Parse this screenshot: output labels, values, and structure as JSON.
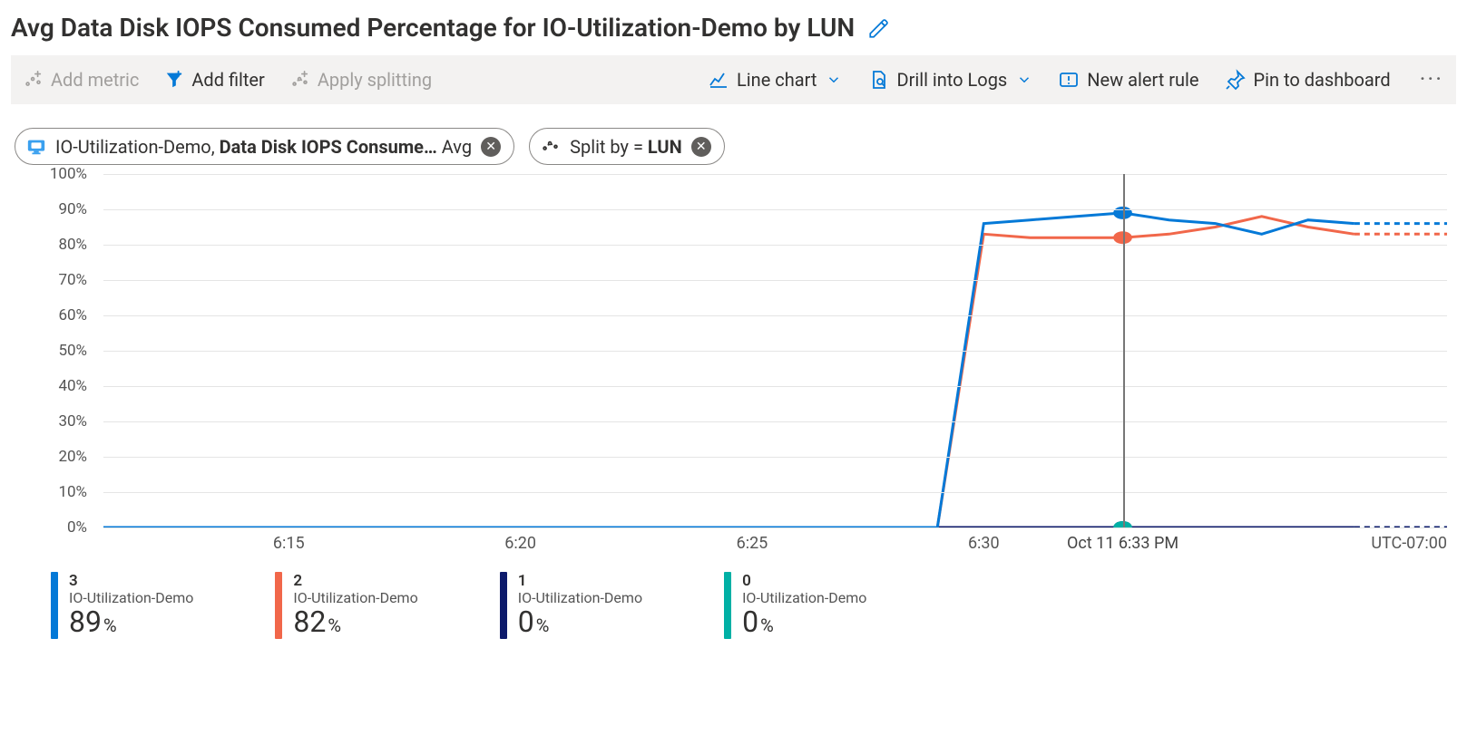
{
  "title": "Avg Data Disk IOPS Consumed Percentage for IO-Utilization-Demo by LUN",
  "toolbar": {
    "add_metric": "Add metric",
    "add_filter": "Add filter",
    "apply_splitting": "Apply splitting",
    "line_chart": "Line chart",
    "drill_logs": "Drill into Logs",
    "new_alert": "New alert rule",
    "pin": "Pin to dashboard"
  },
  "pills": {
    "metric_resource": "IO-Utilization-Demo, ",
    "metric_name": "Data Disk IOPS Consume…",
    "metric_agg": " Avg",
    "split_prefix": "Split by = ",
    "split_value": "LUN"
  },
  "chart_data": {
    "type": "line",
    "ylim": [
      0,
      100
    ],
    "y_ticks": [
      0,
      10,
      20,
      30,
      40,
      50,
      60,
      70,
      80,
      90,
      100
    ],
    "y_tick_labels": [
      "0%",
      "10%",
      "20%",
      "30%",
      "40%",
      "50%",
      "60%",
      "70%",
      "80%",
      "90%",
      "100%"
    ],
    "x": [
      "6:11",
      "6:12",
      "6:13",
      "6:14",
      "6:15",
      "6:16",
      "6:17",
      "6:18",
      "6:19",
      "6:20",
      "6:21",
      "6:22",
      "6:23",
      "6:24",
      "6:25",
      "6:26",
      "6:27",
      "6:28",
      "6:29",
      "6:30",
      "6:31",
      "6:32",
      "6:33",
      "6:34",
      "6:35",
      "6:36",
      "6:37",
      "6:38",
      "6:39",
      "6:40"
    ],
    "x_tick_positions": [
      4,
      9,
      14,
      19
    ],
    "x_tick_labels": [
      "6:15",
      "6:20",
      "6:25",
      "6:30"
    ],
    "tz": "UTC-07:00",
    "cursor_index": 22,
    "cursor_label": "Oct 11 6:33 PM",
    "dashed_from_index": 27,
    "series": [
      {
        "name": "3",
        "resource": "IO-Utilization-Demo",
        "color": "#0479d7",
        "current": 89,
        "values": [
          0,
          0,
          0,
          0,
          0,
          0,
          0,
          0,
          0,
          0,
          0,
          0,
          0,
          0,
          0,
          0,
          0,
          0,
          0,
          86,
          87,
          88,
          89,
          87,
          86,
          83,
          87,
          86,
          86,
          86
        ]
      },
      {
        "name": "2",
        "resource": "IO-Utilization-Demo",
        "color": "#f1674a",
        "current": 82,
        "values": [
          0,
          0,
          0,
          0,
          0,
          0,
          0,
          0,
          0,
          0,
          0,
          0,
          0,
          0,
          0,
          0,
          0,
          0,
          0,
          83,
          82,
          82,
          82,
          83,
          85,
          88,
          85,
          83,
          83,
          83
        ]
      },
      {
        "name": "1",
        "resource": "IO-Utilization-Demo",
        "color": "#0d1a6b",
        "current": 0,
        "values": [
          0,
          0,
          0,
          0,
          0,
          0,
          0,
          0,
          0,
          0,
          0,
          0,
          0,
          0,
          0,
          0,
          0,
          0,
          0,
          0,
          0,
          0,
          0,
          0,
          0,
          0,
          0,
          0,
          0,
          0
        ]
      },
      {
        "name": "0",
        "resource": "IO-Utilization-Demo",
        "color": "#00b0a5",
        "current": 0,
        "values": [
          0,
          0,
          0,
          0,
          0,
          0,
          0,
          0,
          0,
          0,
          0,
          0,
          0,
          0,
          0,
          0,
          0,
          0,
          0,
          0,
          0,
          0,
          0,
          0,
          0,
          0,
          0,
          0,
          0,
          0
        ]
      }
    ]
  }
}
